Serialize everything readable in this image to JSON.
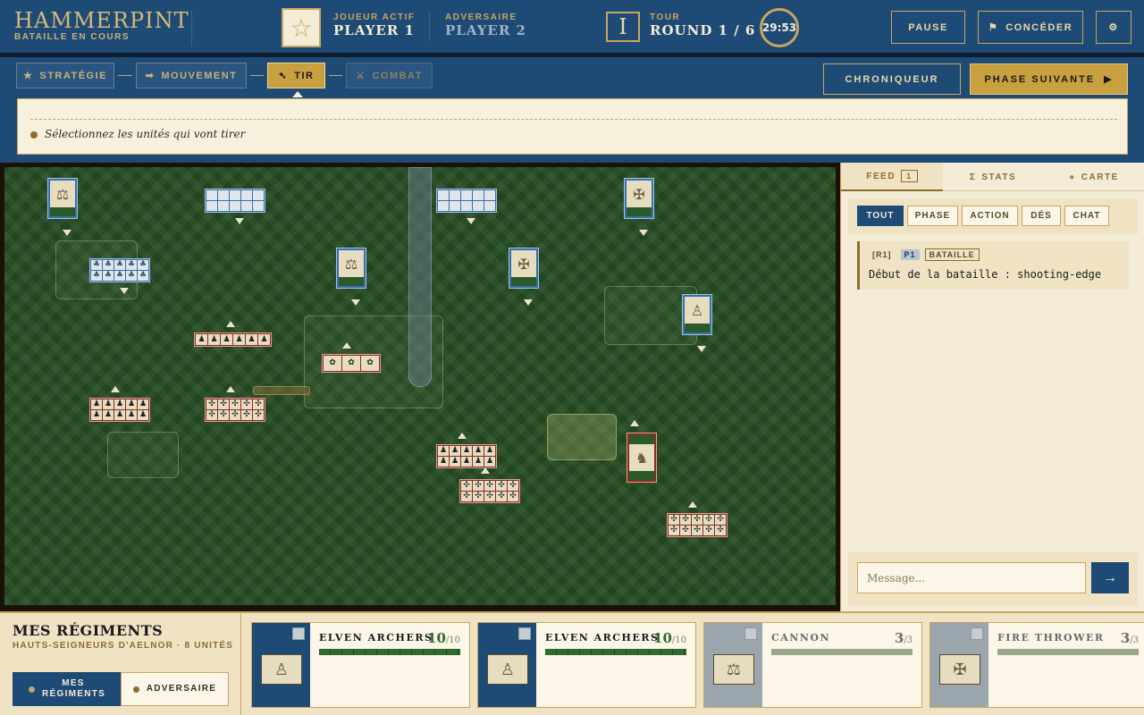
{
  "header": {
    "logo_title": "HAMMERPINT",
    "logo_subtitle": "BATAILLE EN COURS",
    "active_label": "JOUEUR ACTIF",
    "active_player": "PLAYER 1",
    "opponent_label": "ADVERSAIRE",
    "opponent_player": "PLAYER 2",
    "round_icon": "I",
    "round_label": "TOUR",
    "round_value": "ROUND 1 / 6",
    "timer": "29:53",
    "pause_label": "PAUSE",
    "concede_label": "CONCÉDER",
    "icons": {
      "player": "star-icon",
      "concede": "flag-icon",
      "settings": "gear-icon"
    }
  },
  "phases": {
    "items": [
      {
        "label": "STRATÉGIE",
        "icon": "★",
        "state": "done"
      },
      {
        "label": "MOUVEMENT",
        "icon": "➡",
        "state": "done"
      },
      {
        "label": "TIR",
        "icon": "➴",
        "state": "active"
      },
      {
        "label": "COMBAT",
        "icon": "⚔",
        "state": "pending"
      }
    ],
    "chronicler_label": "CHRONIQUEUR",
    "next_label": "PHASE SUIVANTE",
    "next_icon": "▶",
    "instruction": "Sélectionnez les unités qui vont tirer"
  },
  "battlefield": {
    "colors": {
      "player": "#3b6fa8",
      "opponent": "#8a2b22",
      "grass": "#264d23"
    }
  },
  "side": {
    "tabs": {
      "feed": "FEED",
      "feed_count": "1",
      "stats": "STATS",
      "stats_icon": "Σ",
      "map": "CARTE",
      "map_icon": "●"
    },
    "filters": [
      "TOUT",
      "PHASE",
      "ACTION",
      "DÉS",
      "CHAT"
    ],
    "entry": {
      "round": "[R1]",
      "player": "P1",
      "type": "BATAILLE",
      "text": "Début de la bataille : shooting-edge"
    },
    "message_placeholder": "Message...",
    "send_icon": "→"
  },
  "bottom": {
    "title": "MES RÉGIMENTS",
    "subtitle": "HAUTS-SEIGNEURS D'AELNOR · 8 UNITÉS",
    "toggle_mine": "MES RÉGIMENTS",
    "toggle_opponent": "ADVERSAIRE",
    "cards": [
      {
        "name": "ELVEN ARCHERS",
        "count": "10",
        "max": "/10",
        "health": 1.0,
        "portrait": "archer-icon"
      },
      {
        "name": "ELVEN ARCHERS",
        "count": "10",
        "max": "/10",
        "health": 1.0,
        "portrait": "archer-icon"
      },
      {
        "name": "CANNON",
        "count": "3",
        "max": "/3",
        "health": 1.0,
        "portrait": "cannon-icon"
      },
      {
        "name": "FIRE THROWER",
        "count": "3",
        "max": "/3",
        "health": 1.0,
        "portrait": "fire-thrower-icon"
      }
    ]
  }
}
